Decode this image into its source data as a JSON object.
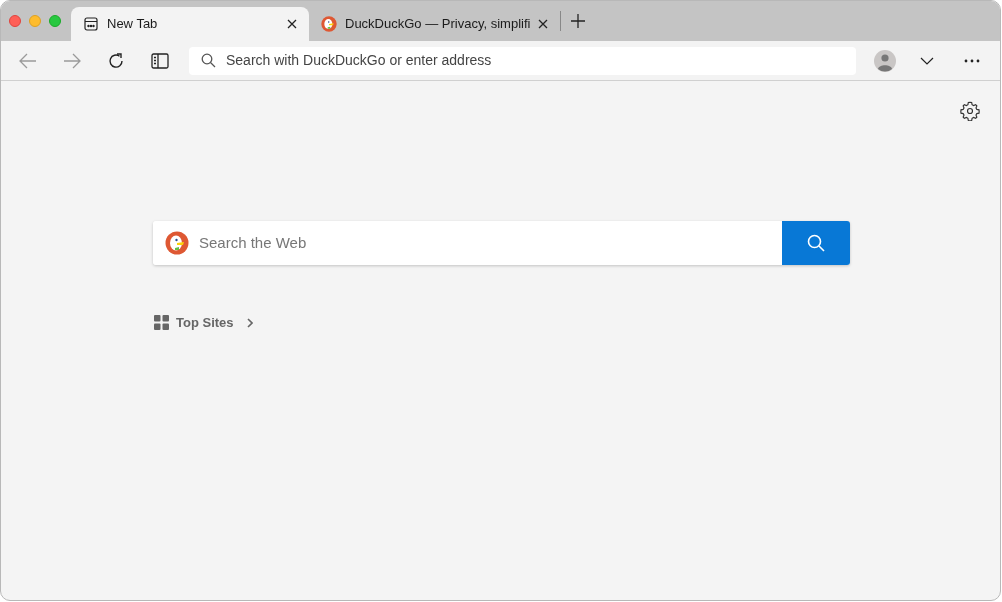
{
  "tabs": [
    {
      "title": "New Tab",
      "selected": true,
      "kind": "newtab"
    },
    {
      "title": "DuckDuckGo — Privacy, simplifi",
      "selected": false,
      "kind": "duck"
    }
  ],
  "address_bar": {
    "placeholder": "Search with DuckDuckGo or enter address"
  },
  "search": {
    "placeholder": "Search the Web"
  },
  "top_sites": {
    "label": "Top Sites"
  }
}
